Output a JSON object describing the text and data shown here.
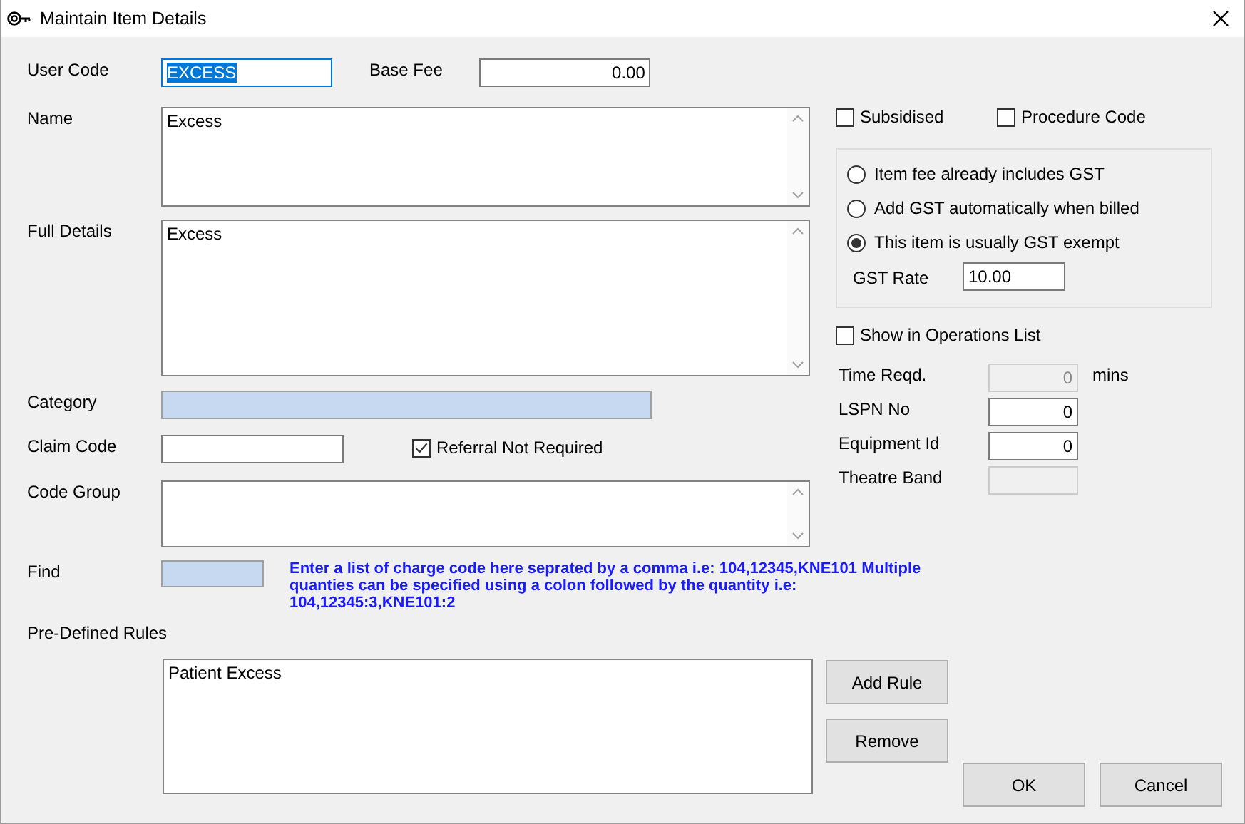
{
  "window": {
    "title": "Maintain Item Details"
  },
  "user_code": {
    "label": "User Code",
    "value": "EXCESS",
    "text_selected": true
  },
  "base_fee": {
    "label": "Base Fee",
    "value": "0.00"
  },
  "name": {
    "label": "Name",
    "value": "Excess"
  },
  "full_details": {
    "label": "Full Details",
    "value": "Excess"
  },
  "category": {
    "label": "Category"
  },
  "claim_code": {
    "label": "Claim Code"
  },
  "referral_not_required": {
    "label": "Referral Not Required",
    "checked": true
  },
  "code_group": {
    "label": "Code Group"
  },
  "find": {
    "label": "Find",
    "hint": "Enter a list of charge code here seprated by a comma i.e: 104,12345,KNE101 Multiple quanties can be specified using a colon followed by the quantity i.e: 104,12345:3,KNE101:2"
  },
  "pre_defined_rules": {
    "label": "Pre-Defined Rules",
    "items": [
      {
        "text": "Patient Excess",
        "selected": false
      }
    ]
  },
  "subsidised": {
    "label": "Subsidised",
    "checked": false
  },
  "procedure_code": {
    "label": "Procedure Code",
    "checked": false
  },
  "gst_options": [
    {
      "label": "Item fee already includes GST",
      "selected": false
    },
    {
      "label": "Add GST automatically when billed",
      "selected": false
    },
    {
      "label": "This item is usually GST exempt",
      "selected": true
    }
  ],
  "gst_rate": {
    "label": "GST Rate",
    "value": "10.00"
  },
  "show_in_operations_list": {
    "label": "Show in Operations List",
    "checked": false
  },
  "numbers": [
    {
      "label": "Time Reqd.",
      "value": "0",
      "unit": "mins",
      "disabled": true
    },
    {
      "label": "LSPN No",
      "value": "0",
      "disabled": false
    },
    {
      "label": "Equipment Id",
      "value": "0",
      "disabled": false
    },
    {
      "label": "Theatre Band",
      "disabled": true
    }
  ],
  "buttons": {
    "add_rule": "Add Rule",
    "remove": "Remove",
    "ok": "OK",
    "cancel": "Cancel"
  }
}
